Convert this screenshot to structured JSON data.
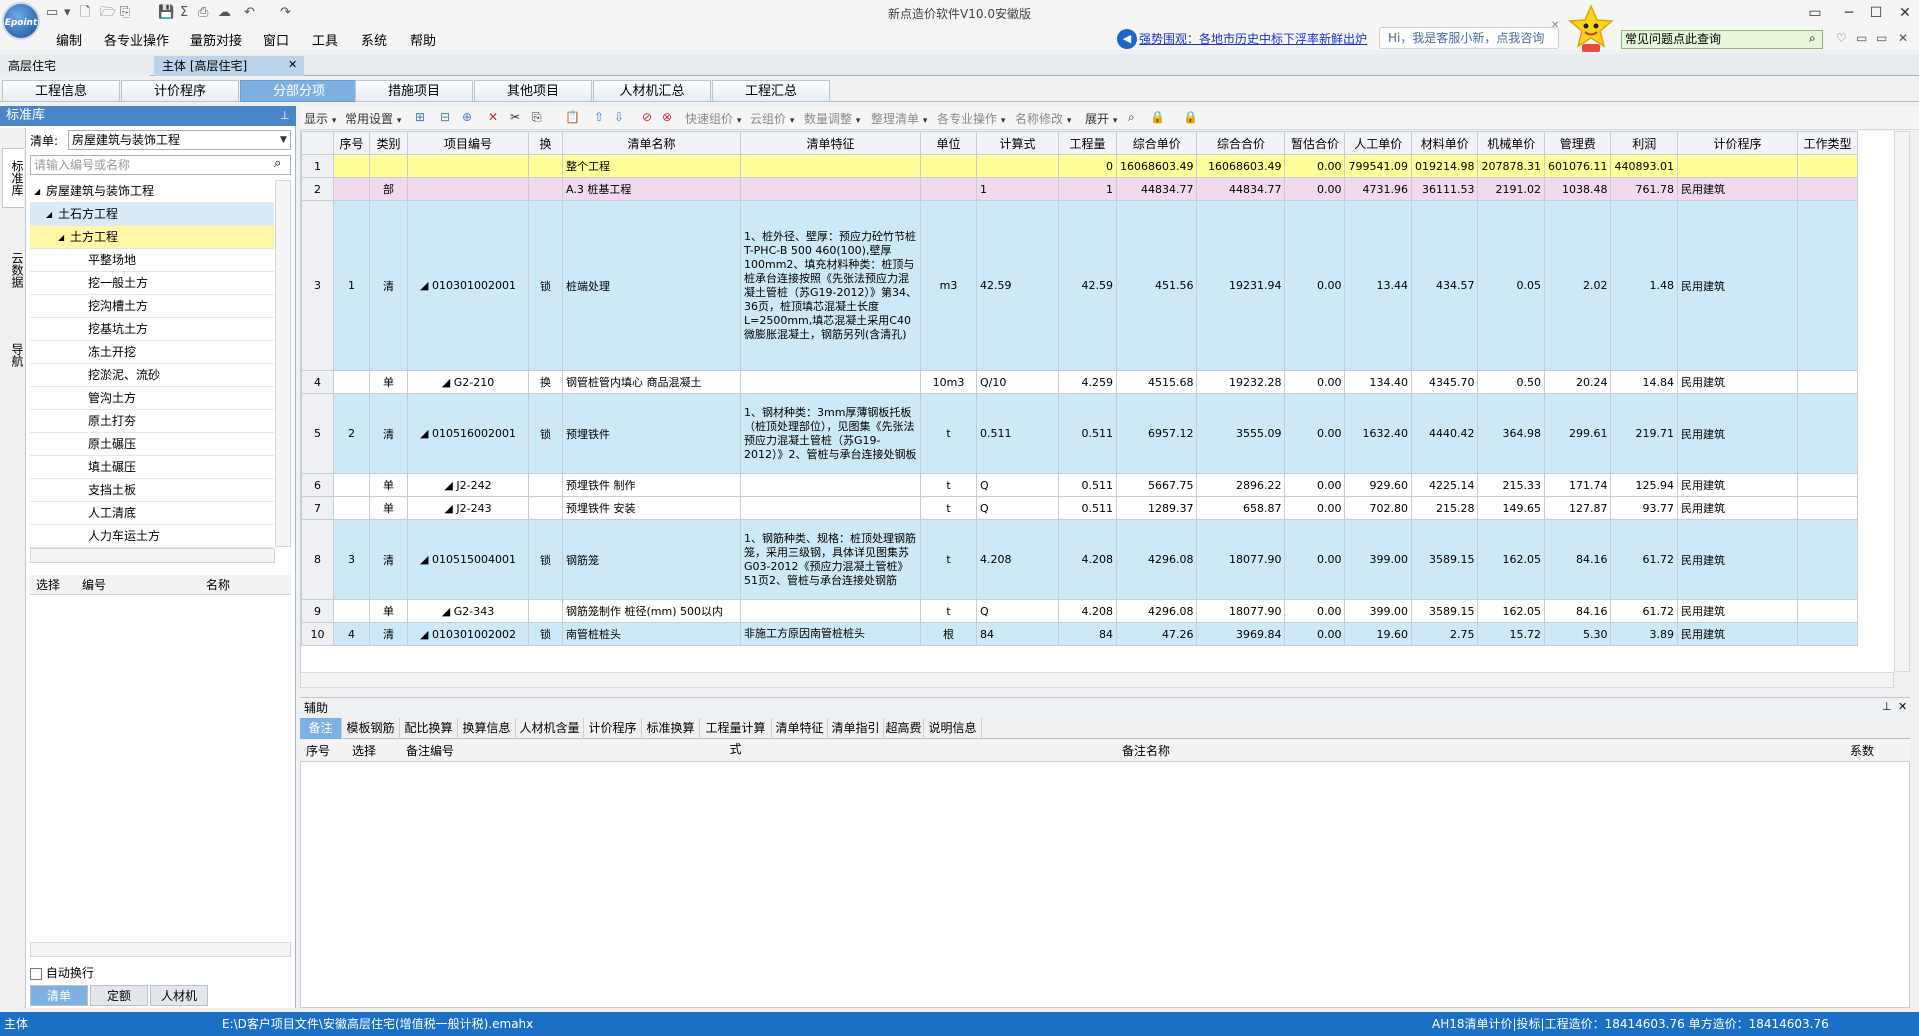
{
  "app": {
    "title": "新点造价软件V10.0安徽版",
    "logo_text": "Epoint",
    "accent": "#1b6fc4"
  },
  "menu": [
    "编制",
    "各专业操作",
    "量筋对接",
    "窗口",
    "工具",
    "系统",
    "帮助"
  ],
  "notice": "强势围观：各地市历史中标下浮率新鲜出炉",
  "assistant_bubble": "Hi，我是客服小新，点我咨询",
  "question_search": "常见问题点此查询",
  "doc_tabs": [
    "高层住宅",
    "主体 [高层住宅]"
  ],
  "main_tabs": [
    "工程信息",
    "计价程序",
    "分部分项",
    "措施项目",
    "其他项目",
    "人材机汇总",
    "工程汇总"
  ],
  "left": {
    "header": "标准库",
    "side_tabs": [
      "标准库",
      "云数据",
      "导航"
    ],
    "lib_label": "清单:",
    "lib_value": "房屋建筑与装饰工程",
    "search_placeholder": "请输入编号或名称",
    "tree": [
      {
        "label": "房屋建筑与装饰工程",
        "level": 0,
        "toggle": "◢",
        "state": ""
      },
      {
        "label": "土石方工程",
        "level": 1,
        "toggle": "◢",
        "state": "sel1"
      },
      {
        "label": "土方工程",
        "level": 2,
        "toggle": "◢",
        "state": "sel2"
      },
      {
        "label": "平整场地",
        "level": 3,
        "toggle": "",
        "state": ""
      },
      {
        "label": "挖一般土方",
        "level": 3,
        "toggle": "",
        "state": ""
      },
      {
        "label": "挖沟槽土方",
        "level": 3,
        "toggle": "",
        "state": ""
      },
      {
        "label": "挖基坑土方",
        "level": 3,
        "toggle": "",
        "state": ""
      },
      {
        "label": "冻土开挖",
        "level": 3,
        "toggle": "",
        "state": ""
      },
      {
        "label": "挖淤泥、流砂",
        "level": 3,
        "toggle": "",
        "state": ""
      },
      {
        "label": "管沟土方",
        "level": 3,
        "toggle": "",
        "state": ""
      },
      {
        "label": "原土打夯",
        "level": 3,
        "toggle": "",
        "state": ""
      },
      {
        "label": "原土碾压",
        "level": 3,
        "toggle": "",
        "state": ""
      },
      {
        "label": "填土碾压",
        "level": 3,
        "toggle": "",
        "state": ""
      },
      {
        "label": "支挡土板",
        "level": 3,
        "toggle": "",
        "state": ""
      },
      {
        "label": "人工清底",
        "level": 3,
        "toggle": "",
        "state": ""
      },
      {
        "label": "人力车运土方",
        "level": 3,
        "toggle": "",
        "state": ""
      }
    ],
    "sub_columns": [
      "选择",
      "编号",
      "名称"
    ],
    "autowrap_label": "自动换行",
    "bottom_tabs": [
      "清单",
      "定额",
      "人材机"
    ]
  },
  "toolbar": [
    "显示",
    "常用设置",
    "快速组价",
    "云组价",
    "数量调整",
    "整理清单",
    "各专业操作",
    "名称修改",
    "展开"
  ],
  "grid": {
    "columns": [
      "",
      "序号",
      "类别",
      "项目编号",
      "换",
      "清单名称",
      "清单特征",
      "单位",
      "计算式",
      "工程量",
      "综合单价",
      "综合合价",
      "暂估合价",
      "人工单价",
      "材料单价",
      "机械单价",
      "管理费",
      "利润",
      "计价程序",
      "工作类型"
    ],
    "rows": [
      {
        "style": "r-yellow",
        "cells": [
          "1",
          "",
          "",
          "",
          "",
          "整个工程",
          "",
          "",
          "",
          "0",
          "16068603.49",
          "16068603.49",
          "0.00",
          "799541.09",
          "019214.98",
          "207878.31",
          "601076.11",
          "440893.01",
          "",
          ""
        ]
      },
      {
        "style": "r-pink",
        "cells": [
          "2",
          "",
          "部",
          "",
          "",
          "A.3 桩基工程",
          "",
          "",
          "1",
          "1",
          "44834.77",
          "44834.77",
          "0.00",
          "4731.96",
          "36111.53",
          "2191.02",
          "1038.48",
          "761.78",
          "民用建筑",
          ""
        ]
      },
      {
        "style": "r-blue",
        "cells": [
          "3",
          "1",
          "清",
          "010301002001",
          "锁",
          "桩端处理",
          "1、桩外径、壁厚：预应力砼竹节桩T-PHC-B 500 460(100),壁厚100mm2、填充材料种类：桩顶与桩承台连接按照《先张法预应力混凝土管桩（苏G19-2012）》第34、36页，桩顶填芯混凝土长度 L=2500mm,填芯混凝土采用C40微膨胀混凝土，钢筋另列(含清孔)",
          "m3",
          "42.59",
          "42.59",
          "451.56",
          "19231.94",
          "0.00",
          "13.44",
          "434.57",
          "0.05",
          "2.02",
          "1.48",
          "民用建筑",
          ""
        ]
      },
      {
        "style": "r-white",
        "cells": [
          "4",
          "",
          "单",
          "G2-210",
          "换",
          "钢管桩管内填心 商品混凝土",
          "",
          "10m3",
          "Q/10",
          "4.259",
          "4515.68",
          "19232.28",
          "0.00",
          "134.40",
          "4345.70",
          "0.50",
          "20.24",
          "14.84",
          "民用建筑",
          ""
        ]
      },
      {
        "style": "r-blue",
        "cells": [
          "5",
          "2",
          "清",
          "010516002001",
          "锁",
          "预埋铁件",
          "1、钢材种类：3mm厚薄钢板托板（桩顶处理部位），见图集《先张法预应力混凝土管桩（苏G19-2012）》2、管桩与承台连接处钢板",
          "t",
          "0.511",
          "0.511",
          "6957.12",
          "3555.09",
          "0.00",
          "1632.40",
          "4440.42",
          "364.98",
          "299.61",
          "219.71",
          "民用建筑",
          ""
        ]
      },
      {
        "style": "r-white",
        "cells": [
          "6",
          "",
          "单",
          "J2-242",
          "",
          "预埋铁件 制作",
          "",
          "t",
          "Q",
          "0.511",
          "5667.75",
          "2896.22",
          "0.00",
          "929.60",
          "4225.14",
          "215.33",
          "171.74",
          "125.94",
          "民用建筑",
          ""
        ]
      },
      {
        "style": "r-white",
        "cells": [
          "7",
          "",
          "单",
          "J2-243",
          "",
          "预埋铁件 安装",
          "",
          "t",
          "Q",
          "0.511",
          "1289.37",
          "658.87",
          "0.00",
          "702.80",
          "215.28",
          "149.65",
          "127.87",
          "93.77",
          "民用建筑",
          ""
        ]
      },
      {
        "style": "r-blue",
        "cells": [
          "8",
          "3",
          "清",
          "010515004001",
          "锁",
          "钢筋笼",
          "1、钢筋种类、规格：桩顶处理钢筋笼，采用三级钢，具体详见图集苏G03-2012《预应力混凝土管桩》51页2、管桩与承台连接处钢筋",
          "t",
          "4.208",
          "4.208",
          "4296.08",
          "18077.90",
          "0.00",
          "399.00",
          "3589.15",
          "162.05",
          "84.16",
          "61.72",
          "民用建筑",
          ""
        ]
      },
      {
        "style": "r-white",
        "cells": [
          "9",
          "",
          "单",
          "G2-343",
          "",
          "钢筋笼制作 桩径(mm) 500以内",
          "",
          "t",
          "Q",
          "4.208",
          "4296.08",
          "18077.90",
          "0.00",
          "399.00",
          "3589.15",
          "162.05",
          "84.16",
          "61.72",
          "民用建筑",
          ""
        ]
      },
      {
        "style": "r-blue",
        "cells": [
          "10",
          "4",
          "清",
          "010301002002",
          "锁",
          "南管桩桩头",
          "非施工方原因南管桩桩头",
          "根",
          "84",
          "84",
          "47.26",
          "3969.84",
          "0.00",
          "19.60",
          "2.75",
          "15.72",
          "5.30",
          "3.89",
          "民用建筑",
          ""
        ]
      }
    ]
  },
  "aux": {
    "header": "辅助",
    "tabs": [
      "备注",
      "模板钢筋",
      "配比换算",
      "换算信息",
      "人材机含量",
      "计价程序",
      "标准换算",
      "工程量计算式",
      "清单特征",
      "清单指引",
      "超高费",
      "说明信息"
    ],
    "columns": [
      "序号",
      "选择",
      "备注编号",
      "备注名称",
      "系数"
    ]
  },
  "status": {
    "mode": "主体",
    "path": "E:\\D客户项目文件\\安徽高层住宅(增值税一般计税).emahx",
    "right": "AH18清单计价|投标|工程造价：18414603.76 单方造价：18414603.76"
  }
}
